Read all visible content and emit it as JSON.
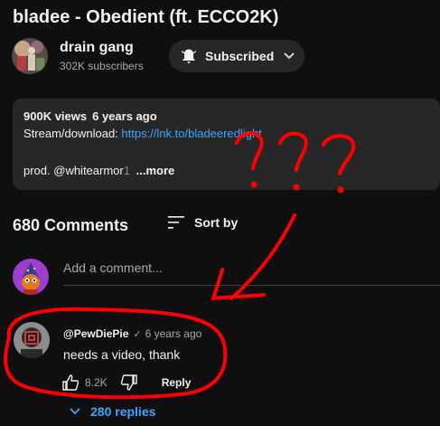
{
  "video": {
    "title": "bladee - Obedient (ft. ECCO2K)"
  },
  "channel": {
    "name": "drain gang",
    "subscribers": "302K subscribers",
    "subscribe_label": "Subscribed",
    "avatar_icon": "drain-gang-avatar"
  },
  "description": {
    "views": "900K views",
    "age": "6 years ago",
    "stream_prefix": "Stream/download:",
    "stream_link": "https://lnk.to/bladeeredlight",
    "prod_text": "prod. @whitearmor",
    "prod_fade": "1",
    "more_label": "...more"
  },
  "comments": {
    "count_label": "680 Comments",
    "sort_label": "Sort by",
    "add_placeholder": "Add a comment...",
    "items": [
      {
        "author": "@PewDiePie",
        "verified_icon": "check-icon",
        "time": "6 years ago",
        "text": "needs a video, thank",
        "likes": "8.2K",
        "reply_label": "Reply",
        "replies_label": "280 replies"
      }
    ]
  },
  "annotation": {
    "text": "???",
    "color": "#ff0000"
  },
  "colors": {
    "background": "#0f0f0f",
    "surface": "#272727",
    "link": "#3ea6ff",
    "secondary_text": "#aaaaaa"
  }
}
